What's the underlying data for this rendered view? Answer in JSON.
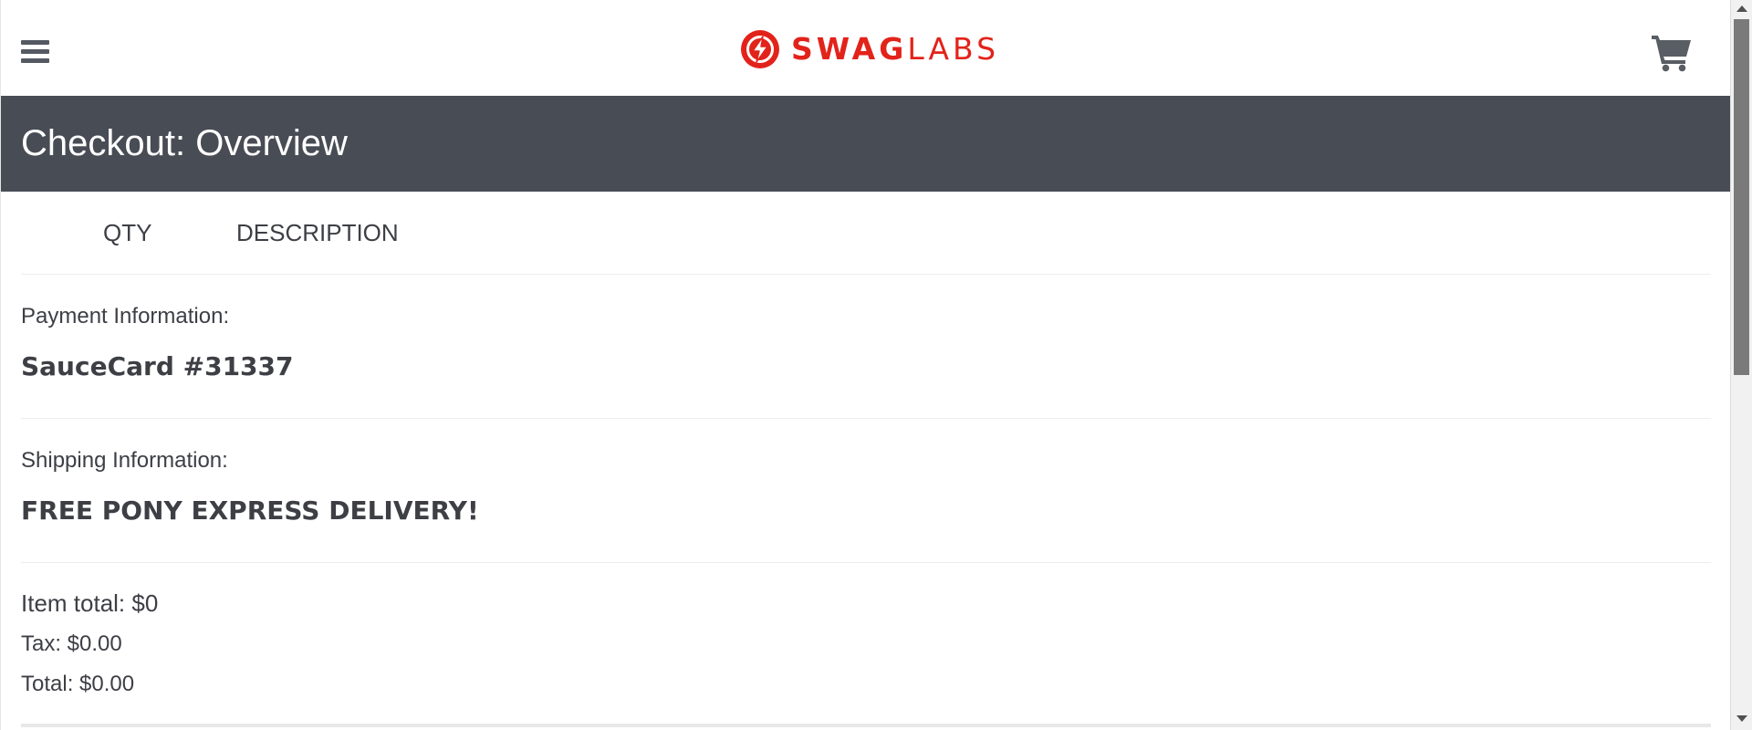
{
  "header": {
    "menu_icon": "hamburger-menu-icon",
    "logo": {
      "icon": "lightning-bolt-logo-icon",
      "text_bold": "SWAG",
      "text_light": "LABS",
      "color": "#e2231a"
    },
    "cart_icon": "shopping-cart-icon"
  },
  "secondary_header": {
    "title": "Checkout: Overview",
    "background": "#484c55"
  },
  "cart_list": {
    "qty_label": "QTY",
    "description_label": "DESCRIPTION"
  },
  "summary": {
    "payment_label": "Payment Information:",
    "payment_value": "SauceCard #31337",
    "shipping_label": "Shipping Information:",
    "shipping_value": "FREE PONY EXPRESS DELIVERY!",
    "item_total": "Item total: $0",
    "tax": "Tax: $0.00",
    "total": "Total: $0.00"
  }
}
